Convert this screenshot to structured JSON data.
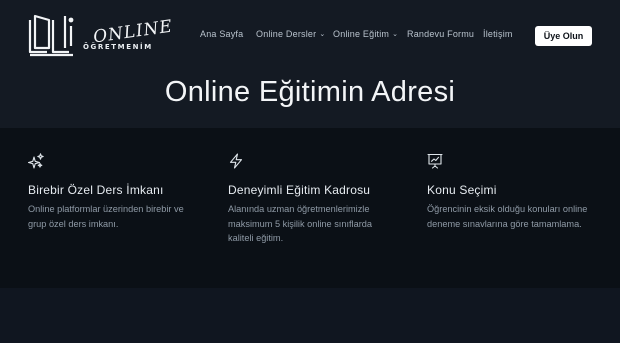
{
  "header": {
    "logo": {
      "word": "ONLINE",
      "subtitle": "ÖĞRETMENİM"
    },
    "nav": [
      {
        "label": "Ana Sayfa",
        "dropdown": false
      },
      {
        "label": "Online Dersler",
        "dropdown": true
      },
      {
        "label": "Online Eğitim",
        "dropdown": true
      },
      {
        "label": "Randevu Formu",
        "dropdown": false
      },
      {
        "label": "İletişim",
        "dropdown": false
      }
    ],
    "cta_label": "Üye Olun"
  },
  "hero": {
    "title": "Online Eğitimin Adresi"
  },
  "features": [
    {
      "icon": "sparkles-icon",
      "title": "Birebir Özel Ders İmkanı",
      "text": "Online platformlar üzerinden birebir ve grup özel ders imkanı."
    },
    {
      "icon": "lightning-icon",
      "title": "Deneyimli Eğitim Kadrosu",
      "text": "Alanında uzman öğretmenlerimizle maksimum 5 kişilik online sınıflarda kaliteli eğitim."
    },
    {
      "icon": "presentation-chart-icon",
      "title": "Konu Seçimi",
      "text": "Öğrencinin eksik olduğu konuları online deneme sınavlarına göre tamamlama."
    }
  ],
  "colors": {
    "hero_bg": "#141a23",
    "features_bg": "#0b1016",
    "cta_bg": "#ffffff",
    "text_primary": "#e8edf2",
    "text_muted": "#8f9aa6"
  }
}
